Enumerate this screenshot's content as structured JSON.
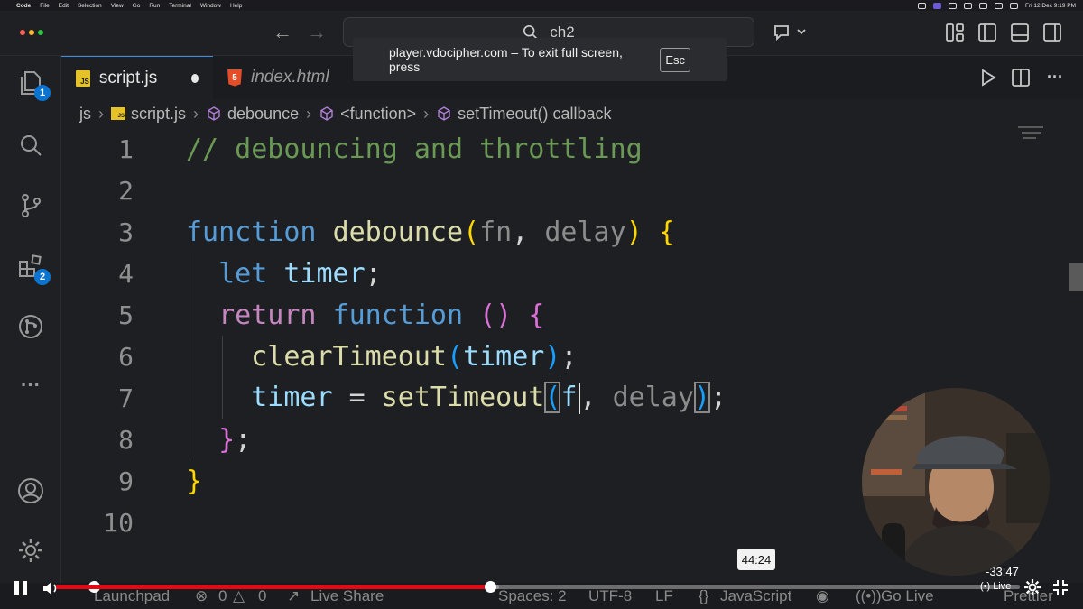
{
  "menubar": {
    "apple": "",
    "items": [
      "Code",
      "File",
      "Edit",
      "Selection",
      "View",
      "Go",
      "Run",
      "Terminal",
      "Window",
      "Help"
    ],
    "clock": "Fri 12 Dec 9:19 PM"
  },
  "titlebar": {
    "search_text": "ch2"
  },
  "fullscreen_notice": {
    "message": "player.vdocipher.com – To exit full screen, press",
    "key": "Esc"
  },
  "activity": {
    "explorer_badge": "1",
    "extensions_badge": "2",
    "more": "···"
  },
  "tabs": [
    {
      "label": "script.js",
      "icon": "JS",
      "dirty": true,
      "active": true
    },
    {
      "label": "index.html",
      "icon": "5",
      "dirty": false,
      "active": false
    }
  ],
  "breadcrumb": {
    "folder": "js",
    "file": "script.js",
    "sym1": "debounce",
    "sym2": "<function>",
    "sym3": "setTimeout() callback"
  },
  "editor": {
    "line_numbers": [
      "1",
      "2",
      "3",
      "4",
      "5",
      "6",
      "7",
      "8",
      "9",
      "10"
    ],
    "lines": [
      [
        {
          "t": "// debouncing and throttling",
          "c": "comment"
        }
      ],
      [],
      [
        {
          "t": "function",
          "c": "kw"
        },
        {
          "t": " ",
          "c": "plain"
        },
        {
          "t": "debounce",
          "c": "fn"
        },
        {
          "t": "(",
          "c": "br1"
        },
        {
          "t": "fn",
          "c": "param-dim"
        },
        {
          "t": ", ",
          "c": "plain"
        },
        {
          "t": "delay",
          "c": "param-dim"
        },
        {
          "t": ")",
          "c": "br1"
        },
        {
          "t": " ",
          "c": "plain"
        },
        {
          "t": "{",
          "c": "br1"
        }
      ],
      [
        {
          "t": "  ",
          "c": "plain"
        },
        {
          "t": "let",
          "c": "kw"
        },
        {
          "t": " ",
          "c": "plain"
        },
        {
          "t": "timer",
          "c": "var"
        },
        {
          "t": ";",
          "c": "plain"
        }
      ],
      [
        {
          "t": "  ",
          "c": "plain"
        },
        {
          "t": "return",
          "c": "ctrl"
        },
        {
          "t": " ",
          "c": "plain"
        },
        {
          "t": "function",
          "c": "kw"
        },
        {
          "t": " ",
          "c": "plain"
        },
        {
          "t": "()",
          "c": "br2"
        },
        {
          "t": " ",
          "c": "plain"
        },
        {
          "t": "{",
          "c": "br2"
        }
      ],
      [
        {
          "t": "    ",
          "c": "plain"
        },
        {
          "t": "clearTimeout",
          "c": "fn"
        },
        {
          "t": "(",
          "c": "br3"
        },
        {
          "t": "timer",
          "c": "var"
        },
        {
          "t": ")",
          "c": "br3"
        },
        {
          "t": ";",
          "c": "plain"
        }
      ],
      [
        {
          "t": "    ",
          "c": "plain"
        },
        {
          "t": "timer",
          "c": "var"
        },
        {
          "t": " = ",
          "c": "plain"
        },
        {
          "t": "setTimeout",
          "c": "fn"
        },
        {
          "t": "(",
          "c": "br3 match"
        },
        {
          "t": "f",
          "c": "var"
        },
        {
          "t": "|",
          "c": "cursor"
        },
        {
          "t": ", ",
          "c": "plain"
        },
        {
          "t": "delay",
          "c": "param-dim"
        },
        {
          "t": ")",
          "c": "br3 match"
        },
        {
          "t": ";",
          "c": "plain"
        }
      ],
      [
        {
          "t": "  ",
          "c": "plain"
        },
        {
          "t": "}",
          "c": "br2"
        },
        {
          "t": ";",
          "c": "plain"
        }
      ],
      [
        {
          "t": "}",
          "c": "br1"
        }
      ],
      []
    ]
  },
  "statusbar": {
    "launchpad": "Launchpad",
    "errors": "0",
    "warnings": "0",
    "live_share": "Live Share",
    "spaces": "Spaces: 2",
    "encoding": "UTF-8",
    "eol": "LF",
    "language": "JavaScript",
    "go_live": "Go Live",
    "prettier": "Prettier"
  },
  "player": {
    "tooltip_time": "44:24",
    "remaining": "-33:47",
    "live_label": "Live",
    "progress_played_pct": 45,
    "progress_buffered_pct": 46,
    "volume_pct": 100
  },
  "colors": {
    "accent": "#0b74d1",
    "progress_red": "#e50914",
    "js_yellow": "#e6c229",
    "html_orange": "#e44d26"
  }
}
